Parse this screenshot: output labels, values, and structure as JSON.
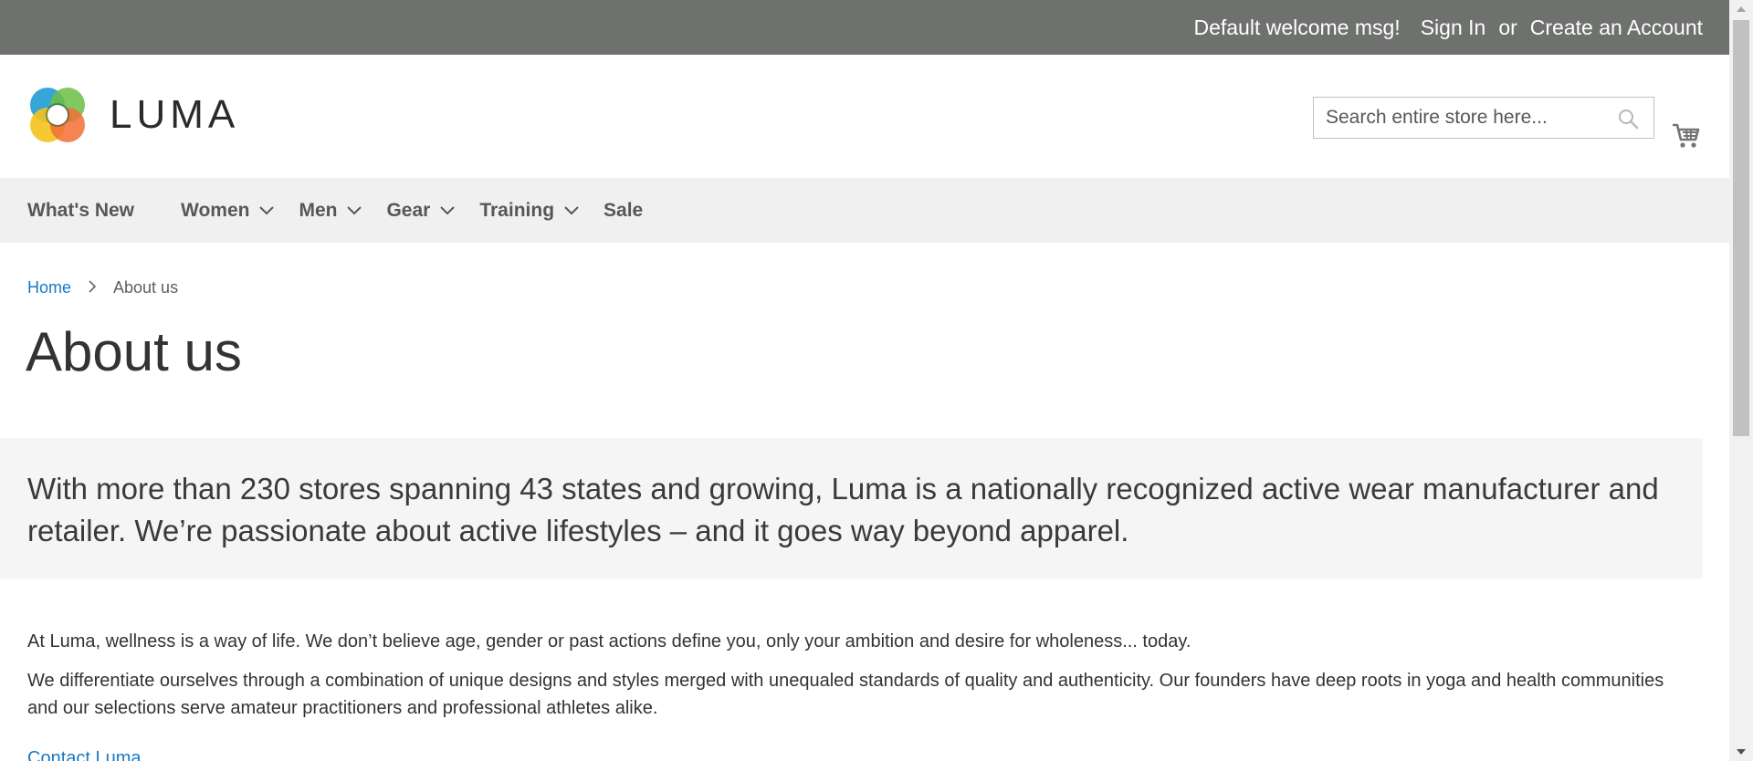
{
  "topbar": {
    "welcome": "Default welcome msg!",
    "sign_in": "Sign In",
    "or": "or",
    "create_account": "Create an Account"
  },
  "header": {
    "logo_text": "LUMA",
    "search_placeholder": "Search entire store here..."
  },
  "nav": {
    "items": [
      {
        "label": "What's New"
      },
      {
        "label": "Women"
      },
      {
        "label": "Men"
      },
      {
        "label": "Gear"
      },
      {
        "label": "Training"
      },
      {
        "label": "Sale"
      }
    ]
  },
  "breadcrumb": {
    "home": "Home",
    "current": "About us"
  },
  "page": {
    "title": "About us",
    "intro": "With more than 230 stores spanning 43 states and growing, Luma is a nationally recognized active wear manufacturer and retailer. We’re passionate about active lifestyles – and it goes way beyond apparel.",
    "para1": "At Luma, wellness is a way of life. We don’t believe age, gender or past actions define you, only your ambition and desire for wholeness... today.",
    "para2": "We differentiate ourselves through a combination of unique designs and styles merged with unequaled standards of quality and authenticity. Our founders have deep roots in yoga and health communities and our selections serve amateur practitioners and professional athletes alike.",
    "contact_link": "Contact Luma"
  },
  "colors": {
    "topbar_bg": "#6e716e",
    "nav_bg": "#f0f0f0",
    "link": "#1979c3",
    "intro_bg": "#f5f5f5"
  }
}
